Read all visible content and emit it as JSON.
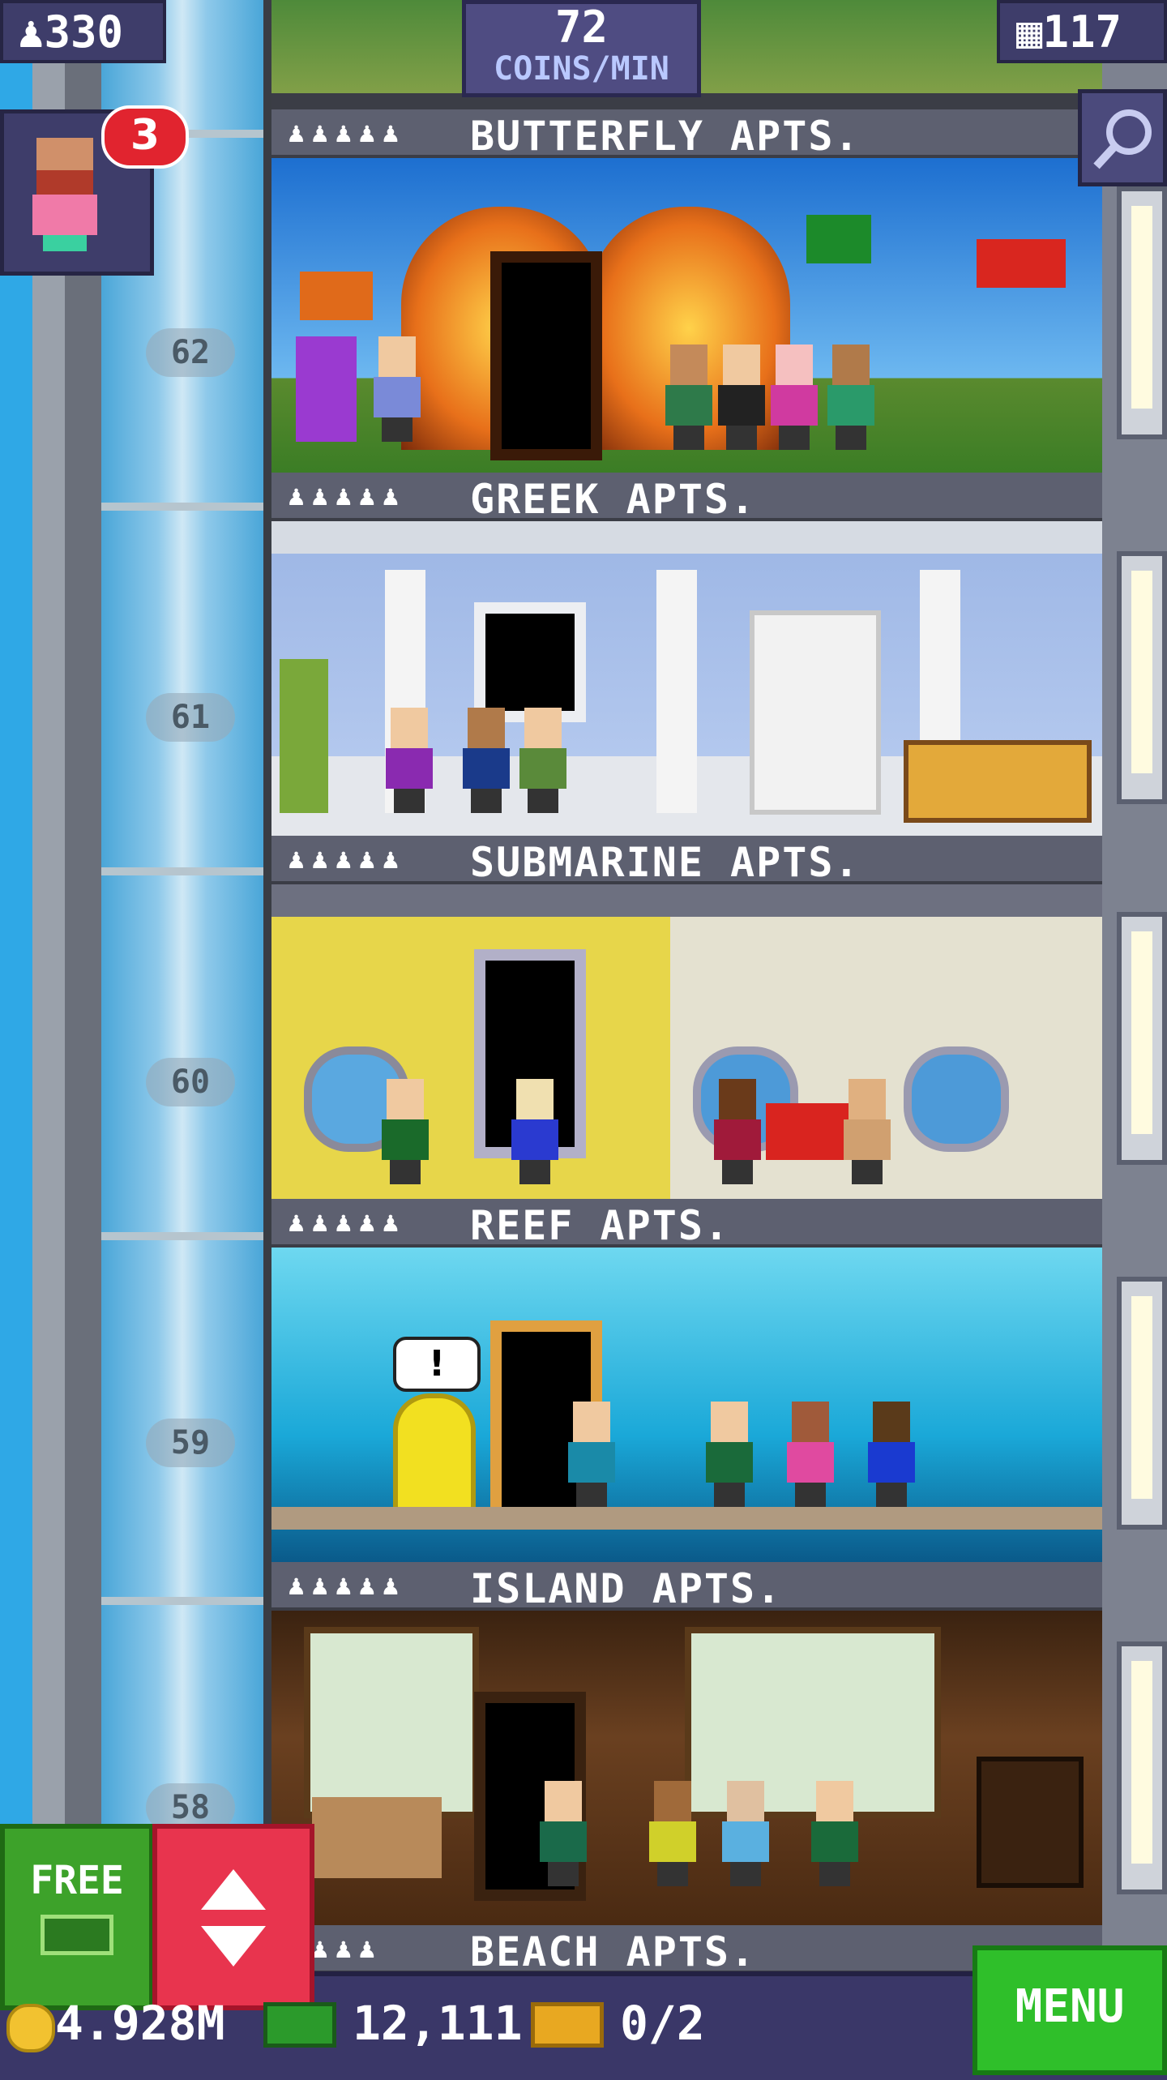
{
  "hud": {
    "population": "330",
    "coins_rate_value": "72",
    "coins_rate_unit": "COINS/MIN",
    "floor_count": "117",
    "visitor_badge": "3"
  },
  "elevator": {
    "floor_numbers": [
      "62",
      "61",
      "60",
      "59",
      "58"
    ]
  },
  "floors": [
    {
      "name": "BUTTERFLY APTS.",
      "residents": "♟♟♟♟♟"
    },
    {
      "name": "GREEK APTS.",
      "residents": "♟♟♟♟♟"
    },
    {
      "name": "SUBMARINE APTS.",
      "residents": "♟♟♟♟♟"
    },
    {
      "name": "REEF APTS.",
      "residents": "♟♟♟♟♟"
    },
    {
      "name": "ISLAND APTS.",
      "residents": "♟♟♟♟♟"
    },
    {
      "name": "BEACH APTS.",
      "residents": "♟♟♟♟"
    }
  ],
  "speech_bubble": "!",
  "buttons": {
    "free_label": "FREE",
    "menu_label": "MENU"
  },
  "currency": {
    "coins": "4.928M",
    "bux": "12,111",
    "tickets": "0/2"
  },
  "colors": {
    "coin": "#f2c230",
    "bux": "#2b9a2b",
    "ticket": "#e8a821",
    "menu_green": "#2fbf2a",
    "elevator_red": "#e8344e"
  }
}
